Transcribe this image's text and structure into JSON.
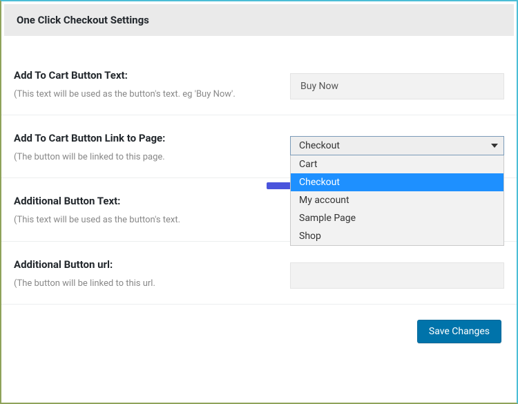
{
  "header": {
    "title": "One Click Checkout Settings"
  },
  "fields": {
    "add_to_cart_text": {
      "label": "Add To Cart Button Text:",
      "help": "(This text will be used as the button's text. eg 'Buy Now'.",
      "value": "Buy Now"
    },
    "add_to_cart_link": {
      "label": "Add To Cart Button Link to Page:",
      "help": "(The button will be linked to this page.",
      "selected": "Checkout",
      "options": [
        "Cart",
        "Checkout",
        "My account",
        "Sample Page",
        "Shop"
      ]
    },
    "additional_text": {
      "label": "Additional Button Text:",
      "help": "(This text will be used as the button's text.",
      "value": ""
    },
    "additional_url": {
      "label": "Additional Button url:",
      "help": "(The button will be linked to this url.",
      "value": ""
    }
  },
  "actions": {
    "save_label": "Save Changes"
  },
  "annotation": {
    "arrow_color": "#4a54dc"
  }
}
